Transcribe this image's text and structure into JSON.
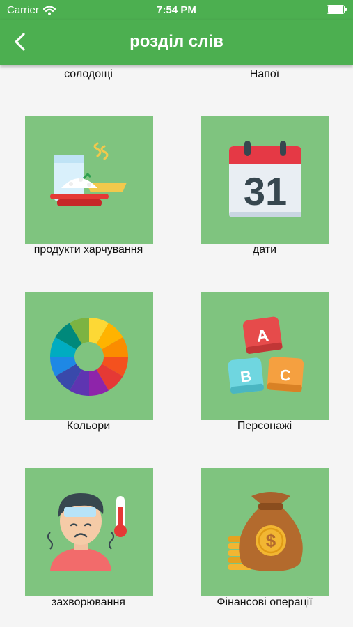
{
  "status_bar": {
    "carrier": "Carrier",
    "time": "7:54 PM"
  },
  "app_bar": {
    "title": "розділ слів"
  },
  "colors": {
    "primary": "#4caf50",
    "tile": "#7fc47f",
    "background": "#f5f5f5"
  },
  "categories": [
    {
      "label": "солодощі",
      "icon": "sweets-icon"
    },
    {
      "label": "Напої",
      "icon": "drinks-icon"
    },
    {
      "label": "продукти харчування",
      "icon": "food-icon"
    },
    {
      "label": "дати",
      "icon": "calendar-icon"
    },
    {
      "label": "Кольори",
      "icon": "color-wheel-icon"
    },
    {
      "label": "Персонажі",
      "icon": "abc-blocks-icon"
    },
    {
      "label": "захворювання",
      "icon": "sick-person-icon"
    },
    {
      "label": "Фінансові операції",
      "icon": "money-bag-icon"
    }
  ]
}
